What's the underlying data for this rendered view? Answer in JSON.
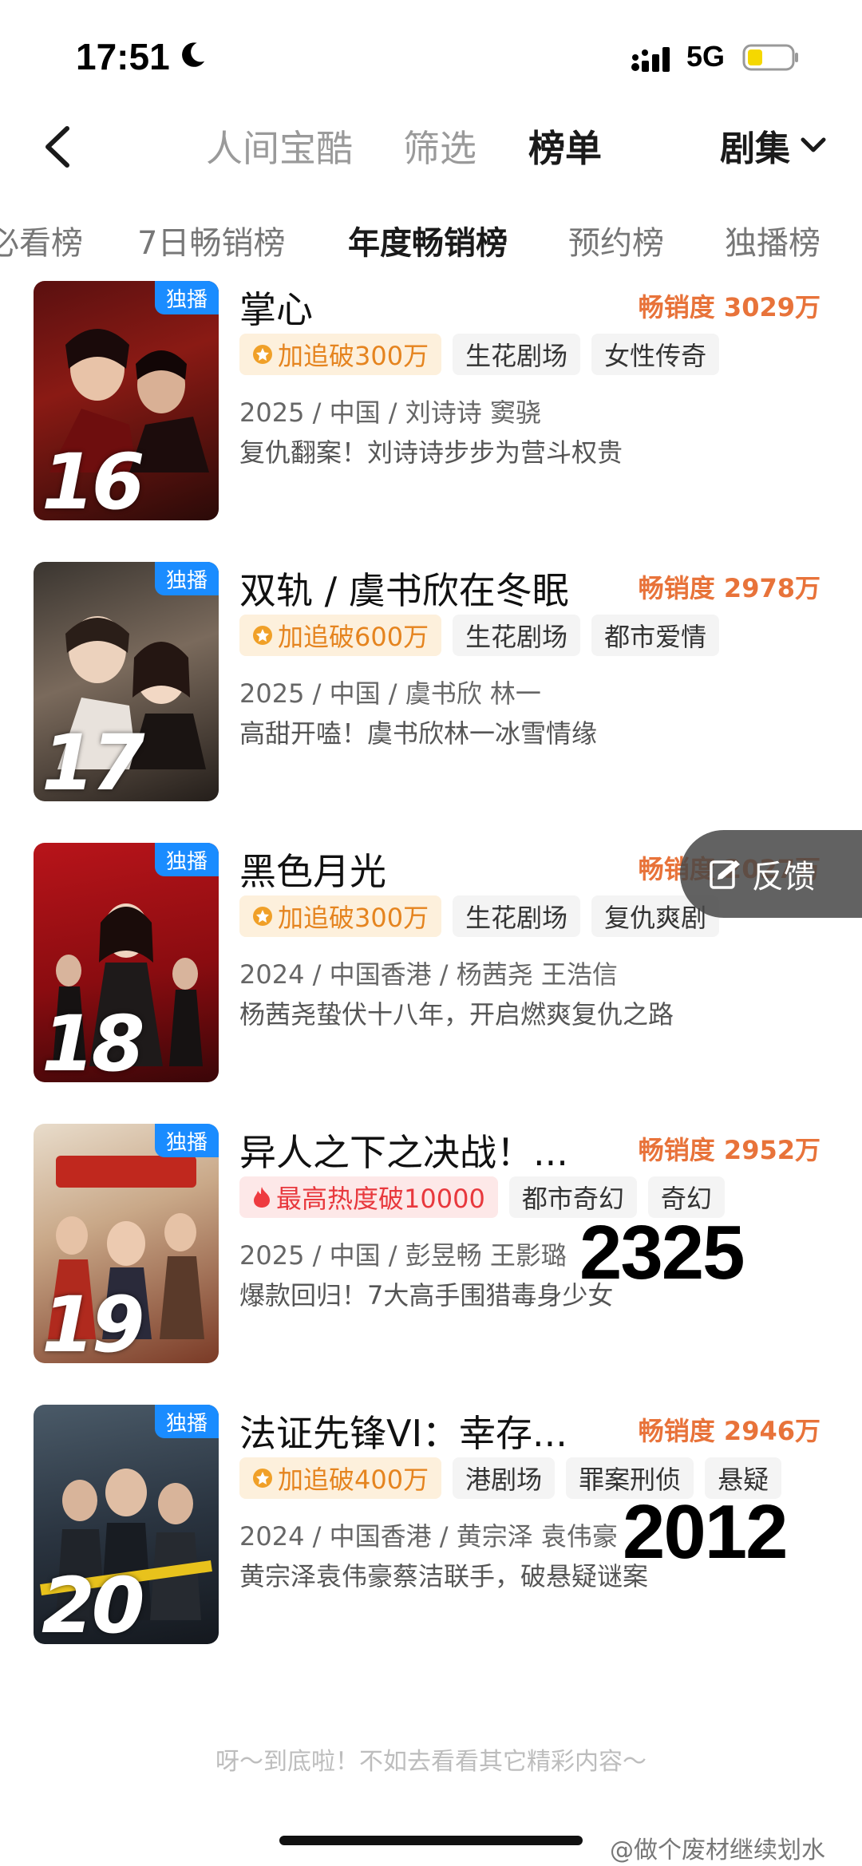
{
  "status": {
    "time": "17:51",
    "network": "5G"
  },
  "header": {
    "tabs": [
      "人间宝酷",
      "筛选",
      "榜单"
    ],
    "active_tab": "榜单",
    "dropdown_label": "剧集"
  },
  "rank_tabs": [
    "必看榜",
    "7日畅销榜",
    "年度畅销榜",
    "预约榜",
    "独播榜"
  ],
  "active_rank_tab": "年度畅销榜",
  "badge_label": "独播",
  "items": [
    {
      "rank": "16",
      "title": "掌心",
      "sales": "畅销度 3029万",
      "tags": [
        "加追破300万",
        "生花剧场",
        "女性传奇"
      ],
      "meta": "2025 / 中国 / 刘诗诗 窦骁",
      "desc": "复仇翻案！刘诗诗步步为营斗权贵"
    },
    {
      "rank": "17",
      "title": "双轨 / 虞书欣在冬眠",
      "sales": "畅销度 2978万",
      "tags": [
        "加追破600万",
        "生花剧场",
        "都市爱情"
      ],
      "meta": "2025 / 中国 / 虞书欣 林一",
      "desc": "高甜开嗑！虞书欣林一冰雪情缘"
    },
    {
      "rank": "18",
      "title": "黑色月光",
      "sales": "畅销度 2027万",
      "tags": [
        "加追破300万",
        "生花剧场",
        "复仇爽剧"
      ],
      "meta": "2024 / 中国香港 / 杨茜尧 王浩信",
      "desc": "杨茜尧蛰伏十八年，开启燃爽复仇之路"
    },
    {
      "rank": "19",
      "title": "异人之下之决战！...",
      "sales": "畅销度 2952万",
      "tags": [
        "最高热度破10000",
        "都市奇幻",
        "奇幻"
      ],
      "meta": "2025 / 中国 / 彭昱畅 王影璐",
      "desc": "爆款回归！7大高手围猎毒身少女"
    },
    {
      "rank": "20",
      "title": "法证先锋VI：幸存...",
      "sales": "畅销度 2946万",
      "tags": [
        "加追破400万",
        "港剧场",
        "罪案刑侦",
        "悬疑"
      ],
      "meta": "2024 / 中国香港 / 黄宗泽 袁伟豪",
      "desc": "黄宗泽袁伟豪蔡洁联手，破悬疑谜案"
    }
  ],
  "overlay_numbers": [
    "2325",
    "2012"
  ],
  "feedback_label": "反馈",
  "end_text": "呀～到底啦！不如去看看其它精彩内容～",
  "watermark": "@做个废材继续划水",
  "colors": {
    "accent_orange": "#e8733a",
    "badge_blue": "#1a8cff",
    "hot_tag": "#e5841f",
    "fire_tag": "#e8383d"
  }
}
